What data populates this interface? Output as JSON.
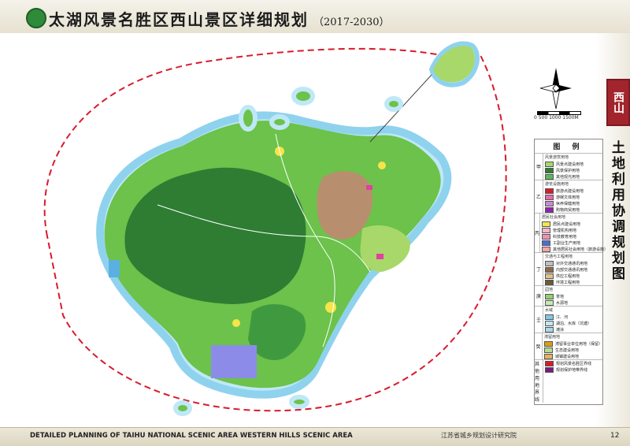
{
  "header": {
    "title": "太湖风景名胜区西山景区详细规划",
    "year": "（2017-2030）"
  },
  "side": {
    "tag": "西山",
    "vertical_title": "土地利用协调规划图"
  },
  "scale": {
    "label": "0    500   1000  1500M"
  },
  "legend": {
    "title": "图 例",
    "groups": [
      {
        "code": "甲",
        "head": "风景游赏用地",
        "items": [
          {
            "label": "风景点建设用地",
            "color": "#a8d86a"
          },
          {
            "label": "风景保护用地",
            "color": "#2e7d32"
          },
          {
            "label": "其他观光用地",
            "color": "#5cb85c"
          }
        ]
      },
      {
        "code": "乙",
        "head": "游览设施用地",
        "items": [
          {
            "label": "旅游点建设用地",
            "color": "#d81b2c"
          },
          {
            "label": "游娱文体用地",
            "color": "#e86aa8"
          },
          {
            "label": "休养保健用地",
            "color": "#c78ad8"
          },
          {
            "label": "购物商贸用地",
            "color": "#8e24aa"
          }
        ]
      },
      {
        "code": "丙",
        "head": "居民社会用地",
        "items": [
          {
            "label": "居民点建设用地",
            "color": "#f5e44a"
          },
          {
            "label": "管理机构用地",
            "color": "#f2b8c6"
          },
          {
            "label": "科技教育用地",
            "color": "#f48fb1"
          },
          {
            "label": "工副业生产用地",
            "color": "#4a6fd1"
          },
          {
            "label": "其他居民社会用地（旅游设施）",
            "color": "#f4a6a6"
          }
        ]
      },
      {
        "code": "丁",
        "head": "交通与工程用地",
        "items": [
          {
            "label": "对外交通通讯用地",
            "color": "#bfbfbf"
          },
          {
            "label": "内部交通通讯用地",
            "color": "#8a6a4a"
          },
          {
            "label": "供应工程用地",
            "color": "#e0c08a"
          },
          {
            "label": "环境工程用地",
            "color": "#6a5a3a"
          }
        ]
      },
      {
        "code": "庚",
        "head": "园地",
        "items": [
          {
            "label": "茶地",
            "color": "#8fd16a"
          },
          {
            "label": "水源地",
            "color": "#c7e9b0"
          }
        ]
      },
      {
        "code": "壬",
        "head": "水域",
        "items": [
          {
            "label": "江、河",
            "color": "#7ec8e8"
          },
          {
            "label": "湖泊、水库（坑塘）",
            "color": "#bfe6f5"
          },
          {
            "label": "滩涂",
            "color": "#a8d8ea"
          }
        ]
      },
      {
        "code": "癸",
        "head": "滞留用地",
        "items": [
          {
            "label": "滞留事业单位用地（保留）",
            "color": "#d4a017"
          },
          {
            "label": "生态建设用地",
            "color": "#b7dc8a"
          },
          {
            "label": "城镇建设用地",
            "color": "#e6b35c"
          }
        ]
      },
      {
        "code": "其他用地界线",
        "head": "",
        "items": [
          {
            "label": "规划风景名胜区界线",
            "color": "#d81b2c"
          },
          {
            "label": "规划保护地带界线",
            "color": "#7a1a7a"
          }
        ]
      }
    ]
  },
  "footer": {
    "english": "DETAILED PLANNING OF TAIHU NATIONAL SCENIC AREA WESTERN HILLS SCENIC AREA",
    "org": "江苏省城乡规划设计研究院",
    "page": "12"
  }
}
